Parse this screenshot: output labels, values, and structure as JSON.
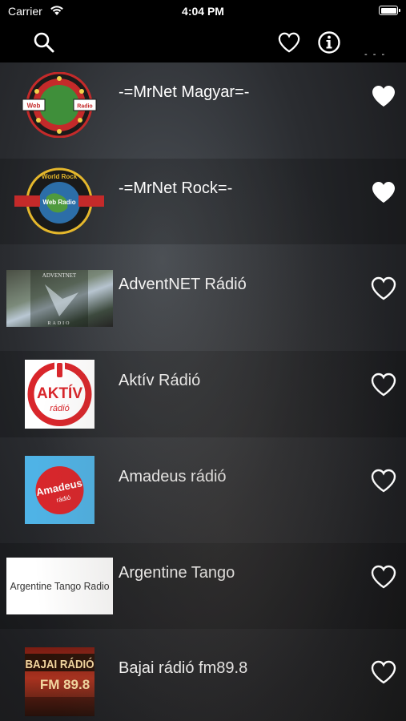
{
  "status_bar": {
    "carrier": "Carrier",
    "time": "4:04 PM"
  },
  "nav": {
    "more_indicator": "- - -"
  },
  "stations": [
    {
      "name": "-=MrNet Magyar=-",
      "favorite": true,
      "logo_icon": "mrnet-magyar-logo",
      "logo_top_text": "Web",
      "logo_mid_text": "Radio"
    },
    {
      "name": "-=MrNet Rock=-",
      "favorite": true,
      "logo_icon": "mrnet-rock-logo",
      "logo_top_text": "World Rock",
      "logo_mid_text": "Web Radio"
    },
    {
      "name": "AdventNET Rádió",
      "favorite": false,
      "logo_icon": "adventnet-logo",
      "logo_top_text": "ADVENTNET",
      "logo_mid_text": "RADIO"
    },
    {
      "name": "Aktív Rádió",
      "favorite": false,
      "logo_icon": "aktiv-logo",
      "logo_top_text": "AKTÍV",
      "logo_mid_text": "rádió"
    },
    {
      "name": "Amadeus rádió",
      "favorite": false,
      "logo_icon": "amadeus-logo",
      "logo_top_text": "Amadeus",
      "logo_mid_text": "rádió"
    },
    {
      "name": "Argentine Tango",
      "favorite": false,
      "logo_icon": "argentine-tango-logo",
      "logo_top_text": "Argentine Tango Radio",
      "logo_mid_text": ""
    },
    {
      "name": "Bajai rádió fm89.8",
      "favorite": false,
      "logo_icon": "bajai-logo",
      "logo_top_text": "BAJAI RÁDIÓ",
      "logo_mid_text": "FM 89.8"
    }
  ],
  "colors": {
    "background": "#000000",
    "text": "#ffffff",
    "aktiv_red": "#d9262b",
    "amadeus_blue": "#4fb3e6"
  }
}
